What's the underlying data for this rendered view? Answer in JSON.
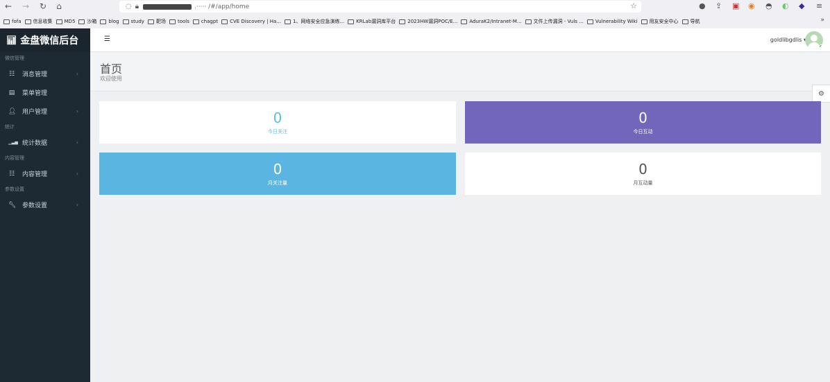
{
  "browser": {
    "url_suffix": ".····· /#/app/home",
    "bookmarks": [
      "fofa",
      "信息收集",
      "MD5",
      "沙箱",
      "blog",
      "study",
      "靶场",
      "tools",
      "chagpt",
      "CVE Discovery | Ha...",
      "1、网络安全应急演练...",
      "KRLab漏洞库平台",
      "2023HW漏洞POC/E...",
      "AduraK2/Intranet-M...",
      "文件上传漏洞 - Vuls ...",
      "Vulnerability Wiki",
      "用友安全中心",
      "导航"
    ]
  },
  "sidebar": {
    "brand": "金盘微信后台",
    "sections": [
      {
        "title": "微信管理",
        "items": [
          {
            "label": "消息管理",
            "icon": "list-icon",
            "chevron": true
          },
          {
            "label": "菜单管理",
            "icon": "menu-icon",
            "chevron": false
          },
          {
            "label": "用户管理",
            "icon": "user-icon",
            "chevron": true
          }
        ]
      },
      {
        "title": "统计",
        "items": [
          {
            "label": "统计数据",
            "icon": "bar-chart-icon",
            "chevron": true
          }
        ]
      },
      {
        "title": "内容管理",
        "items": [
          {
            "label": "内容管理",
            "icon": "list-icon",
            "chevron": true
          }
        ]
      },
      {
        "title": "参数设置",
        "items": [
          {
            "label": "参数设置",
            "icon": "wrench-icon",
            "chevron": true
          }
        ]
      }
    ]
  },
  "topbar": {
    "username": "goldlibgdlis"
  },
  "page": {
    "title": "首页",
    "subtitle": "欢迎使用"
  },
  "cards": [
    {
      "value": "0",
      "label": "今日关注",
      "bg": "#ffffff",
      "color": "#5bc0de"
    },
    {
      "value": "0",
      "label": "今日互动",
      "bg": "#7266ba",
      "color": "#ffffff"
    },
    {
      "value": "0",
      "label": "月关注量",
      "bg": "#5ab5e0",
      "color": "#ffffff"
    },
    {
      "value": "0",
      "label": "月互动量",
      "bg": "#ffffff",
      "color": "#555555"
    }
  ]
}
